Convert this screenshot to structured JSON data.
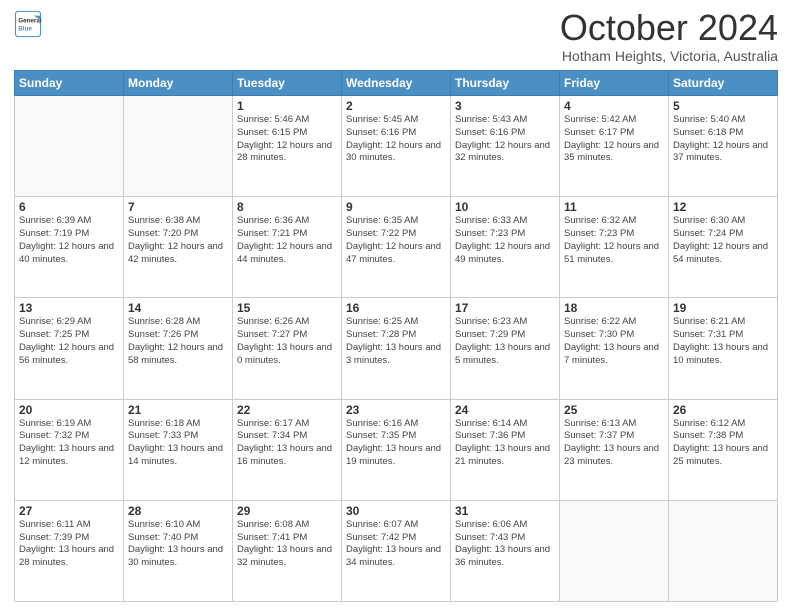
{
  "header": {
    "logo_line1": "General",
    "logo_line2": "Blue",
    "month": "October 2024",
    "location": "Hotham Heights, Victoria, Australia"
  },
  "days_of_week": [
    "Sunday",
    "Monday",
    "Tuesday",
    "Wednesday",
    "Thursday",
    "Friday",
    "Saturday"
  ],
  "weeks": [
    [
      {
        "day": "",
        "info": ""
      },
      {
        "day": "",
        "info": ""
      },
      {
        "day": "1",
        "info": "Sunrise: 5:46 AM\nSunset: 6:15 PM\nDaylight: 12 hours and 28 minutes."
      },
      {
        "day": "2",
        "info": "Sunrise: 5:45 AM\nSunset: 6:16 PM\nDaylight: 12 hours and 30 minutes."
      },
      {
        "day": "3",
        "info": "Sunrise: 5:43 AM\nSunset: 6:16 PM\nDaylight: 12 hours and 32 minutes."
      },
      {
        "day": "4",
        "info": "Sunrise: 5:42 AM\nSunset: 6:17 PM\nDaylight: 12 hours and 35 minutes."
      },
      {
        "day": "5",
        "info": "Sunrise: 5:40 AM\nSunset: 6:18 PM\nDaylight: 12 hours and 37 minutes."
      }
    ],
    [
      {
        "day": "6",
        "info": "Sunrise: 6:39 AM\nSunset: 7:19 PM\nDaylight: 12 hours and 40 minutes."
      },
      {
        "day": "7",
        "info": "Sunrise: 6:38 AM\nSunset: 7:20 PM\nDaylight: 12 hours and 42 minutes."
      },
      {
        "day": "8",
        "info": "Sunrise: 6:36 AM\nSunset: 7:21 PM\nDaylight: 12 hours and 44 minutes."
      },
      {
        "day": "9",
        "info": "Sunrise: 6:35 AM\nSunset: 7:22 PM\nDaylight: 12 hours and 47 minutes."
      },
      {
        "day": "10",
        "info": "Sunrise: 6:33 AM\nSunset: 7:23 PM\nDaylight: 12 hours and 49 minutes."
      },
      {
        "day": "11",
        "info": "Sunrise: 6:32 AM\nSunset: 7:23 PM\nDaylight: 12 hours and 51 minutes."
      },
      {
        "day": "12",
        "info": "Sunrise: 6:30 AM\nSunset: 7:24 PM\nDaylight: 12 hours and 54 minutes."
      }
    ],
    [
      {
        "day": "13",
        "info": "Sunrise: 6:29 AM\nSunset: 7:25 PM\nDaylight: 12 hours and 56 minutes."
      },
      {
        "day": "14",
        "info": "Sunrise: 6:28 AM\nSunset: 7:26 PM\nDaylight: 12 hours and 58 minutes."
      },
      {
        "day": "15",
        "info": "Sunrise: 6:26 AM\nSunset: 7:27 PM\nDaylight: 13 hours and 0 minutes."
      },
      {
        "day": "16",
        "info": "Sunrise: 6:25 AM\nSunset: 7:28 PM\nDaylight: 13 hours and 3 minutes."
      },
      {
        "day": "17",
        "info": "Sunrise: 6:23 AM\nSunset: 7:29 PM\nDaylight: 13 hours and 5 minutes."
      },
      {
        "day": "18",
        "info": "Sunrise: 6:22 AM\nSunset: 7:30 PM\nDaylight: 13 hours and 7 minutes."
      },
      {
        "day": "19",
        "info": "Sunrise: 6:21 AM\nSunset: 7:31 PM\nDaylight: 13 hours and 10 minutes."
      }
    ],
    [
      {
        "day": "20",
        "info": "Sunrise: 6:19 AM\nSunset: 7:32 PM\nDaylight: 13 hours and 12 minutes."
      },
      {
        "day": "21",
        "info": "Sunrise: 6:18 AM\nSunset: 7:33 PM\nDaylight: 13 hours and 14 minutes."
      },
      {
        "day": "22",
        "info": "Sunrise: 6:17 AM\nSunset: 7:34 PM\nDaylight: 13 hours and 16 minutes."
      },
      {
        "day": "23",
        "info": "Sunrise: 6:16 AM\nSunset: 7:35 PM\nDaylight: 13 hours and 19 minutes."
      },
      {
        "day": "24",
        "info": "Sunrise: 6:14 AM\nSunset: 7:36 PM\nDaylight: 13 hours and 21 minutes."
      },
      {
        "day": "25",
        "info": "Sunrise: 6:13 AM\nSunset: 7:37 PM\nDaylight: 13 hours and 23 minutes."
      },
      {
        "day": "26",
        "info": "Sunrise: 6:12 AM\nSunset: 7:38 PM\nDaylight: 13 hours and 25 minutes."
      }
    ],
    [
      {
        "day": "27",
        "info": "Sunrise: 6:11 AM\nSunset: 7:39 PM\nDaylight: 13 hours and 28 minutes."
      },
      {
        "day": "28",
        "info": "Sunrise: 6:10 AM\nSunset: 7:40 PM\nDaylight: 13 hours and 30 minutes."
      },
      {
        "day": "29",
        "info": "Sunrise: 6:08 AM\nSunset: 7:41 PM\nDaylight: 13 hours and 32 minutes."
      },
      {
        "day": "30",
        "info": "Sunrise: 6:07 AM\nSunset: 7:42 PM\nDaylight: 13 hours and 34 minutes."
      },
      {
        "day": "31",
        "info": "Sunrise: 6:06 AM\nSunset: 7:43 PM\nDaylight: 13 hours and 36 minutes."
      },
      {
        "day": "",
        "info": ""
      },
      {
        "day": "",
        "info": ""
      }
    ]
  ]
}
